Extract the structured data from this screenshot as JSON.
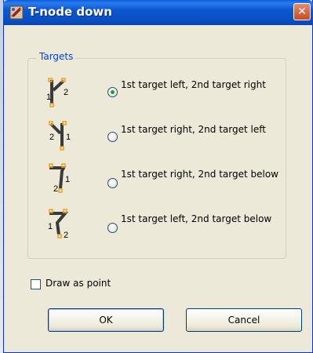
{
  "window": {
    "title": "T-node down",
    "close_symbol": "✕"
  },
  "group": {
    "label": "Targets"
  },
  "options": [
    {
      "label": "1st target left, 2nd target right",
      "selected": true,
      "icon": "t-node-left-right-icon",
      "num_a": "1",
      "num_b": "2"
    },
    {
      "label": "1st target right, 2nd target left",
      "selected": false,
      "icon": "t-node-right-left-icon",
      "num_a": "2",
      "num_b": "1"
    },
    {
      "label": "1st target right, 2nd target below",
      "selected": false,
      "icon": "t-node-right-below-icon",
      "num_a": "1",
      "num_b": "2"
    },
    {
      "label": "1st target left, 2nd target below",
      "selected": false,
      "icon": "t-node-left-below-icon",
      "num_a": "1",
      "num_b": "2"
    }
  ],
  "draw_as_point": {
    "label": "Draw as point",
    "checked": false
  },
  "buttons": {
    "ok": "OK",
    "cancel": "Cancel"
  },
  "colors": {
    "titlebar": "#0a57d0",
    "accent_legend": "#0046d5",
    "radio_dot": "#21a121",
    "node_marker": "#f0a020"
  }
}
